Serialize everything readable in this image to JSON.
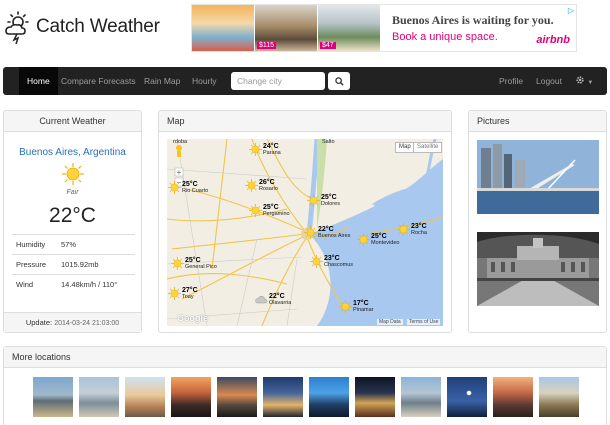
{
  "header": {
    "app_name": "Catch Weather"
  },
  "ad": {
    "title": "Buenos Aires is waiting for you.",
    "subtitle": "Book a unique space.",
    "brand": "airbnb",
    "prices": [
      "$115",
      "$47"
    ],
    "close_icon": "close-icon",
    "colors": {
      "accent": "#e0007a"
    }
  },
  "nav": {
    "home": "Home",
    "compare": "Compare Forecasts",
    "rain_map": "Rain Map",
    "hourly": "Hourly",
    "search_placeholder": "Change city",
    "profile": "Profile",
    "logout": "Logout"
  },
  "current_weather": {
    "heading": "Current Weather",
    "city": "Buenos Aires, Argentina",
    "condition": "Fair",
    "temperature": "22°C",
    "rows": [
      {
        "label": "Humidity",
        "value": "57%"
      },
      {
        "label": "Pressure",
        "value": "1015.92mb"
      },
      {
        "label": "Wind",
        "value": "14.48km/h / 110°"
      }
    ],
    "update_label": "Update:",
    "update_time": "2014-03-24 21:03:00"
  },
  "map": {
    "heading": "Map",
    "map_type": "Map",
    "satellite": "Satellite",
    "footer_data": "Map Data",
    "footer_terms": "Terms of Use",
    "provider": "Google",
    "markers": [
      {
        "temp": "24°C",
        "city": "Parana"
      },
      {
        "temp": "26°C",
        "city": "Rosario"
      },
      {
        "temp": "25°C",
        "city": "Rio Cuarto"
      },
      {
        "temp": "25°C",
        "city": "Pergamino"
      },
      {
        "temp": "25°C",
        "city": "Dolores"
      },
      {
        "temp": "22°C",
        "city": "Buenos Aires"
      },
      {
        "temp": "25°C",
        "city": "Montevideo"
      },
      {
        "temp": "23°C",
        "city": "Rocha"
      },
      {
        "temp": "25°C",
        "city": "General Pico"
      },
      {
        "temp": "23°C",
        "city": "Chascomus"
      },
      {
        "temp": "27°C",
        "city": "Toay"
      },
      {
        "temp": "22°C",
        "city": "Olavarria"
      },
      {
        "temp": "17°C",
        "city": "Pinamar"
      }
    ],
    "edge_labels": {
      "left_top": "rdoba",
      "top_salto": "Salto"
    }
  },
  "pictures": {
    "heading": "Pictures"
  },
  "more_locations": {
    "heading": "More locations"
  }
}
